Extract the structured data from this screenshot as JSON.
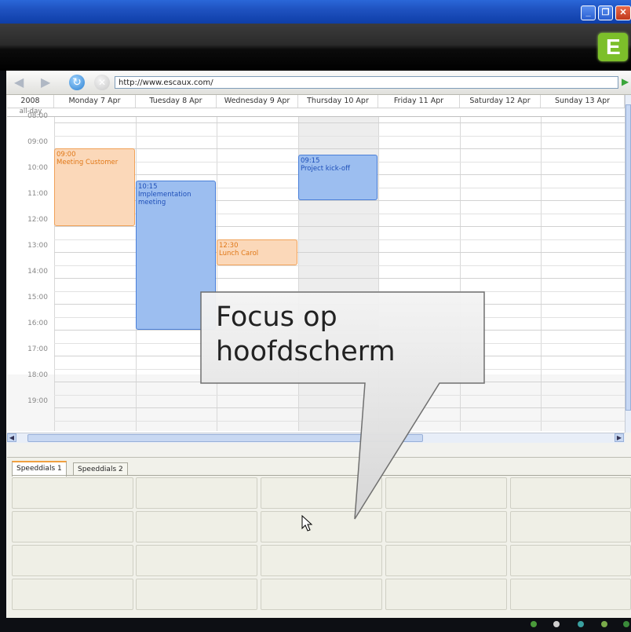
{
  "window": {
    "min_label": "_",
    "max_label": "❐",
    "close_label": "✕"
  },
  "logo_letter": "E",
  "navbar": {
    "back_icon": "◀",
    "forward_icon": "▶",
    "refresh_icon": "↻",
    "stop_icon": "✕",
    "url": "http://www.escaux.com/",
    "go_icon": "▶"
  },
  "calendar": {
    "year": "2008",
    "allday": "all-day",
    "days": [
      "Monday 7 Apr",
      "Tuesday 8 Apr",
      "Wednesday 9 Apr",
      "Thursday 10 Apr",
      "Friday 11 Apr",
      "Saturday 12 Apr",
      "Sunday 13 Apr"
    ],
    "hours": [
      "08:00",
      "09:00",
      "10:00",
      "11:00",
      "12:00",
      "13:00",
      "14:00",
      "15:00",
      "16:00",
      "17:00",
      "18:00",
      "19:00"
    ],
    "events": [
      {
        "day": 0,
        "start": "09:00",
        "end": "12:00",
        "title": "Meeting Customer",
        "color": "orange"
      },
      {
        "day": 1,
        "start": "10:15",
        "end": "16:00",
        "title": "Implementation meeting",
        "color": "blue"
      },
      {
        "day": 2,
        "start": "12:30",
        "end": "13:30",
        "title": "Lunch Carol",
        "color": "orange"
      },
      {
        "day": 3,
        "start": "09:15",
        "end": "11:00",
        "title": "Project kick-off",
        "color": "blue"
      }
    ]
  },
  "speeddials": {
    "tabs": [
      "Speeddials 1",
      "Speeddials 2"
    ],
    "rows": 4,
    "cols": 5
  },
  "callout": {
    "line1": "Focus op",
    "line2": "hoofdscherm"
  },
  "colors": {
    "accent_orange": "#f0a040",
    "event_blue": "#9cbef0",
    "event_orange": "#fbd8b9"
  }
}
